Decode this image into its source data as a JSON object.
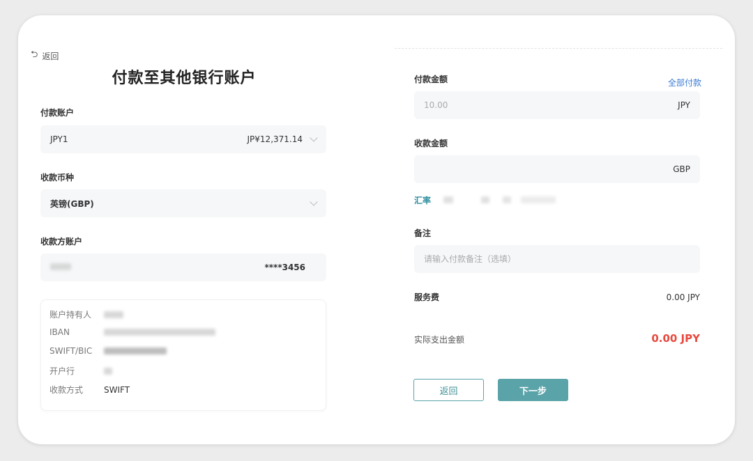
{
  "nav": {
    "back_label": "返回"
  },
  "page": {
    "title": "付款至其他银行账户"
  },
  "left": {
    "pay_account": {
      "label": "付款账户",
      "name": "JPY1",
      "balance": "JP¥12,371.14"
    },
    "receive_currency": {
      "label": "收款币种",
      "value": "英镑(GBP)"
    },
    "payee_account": {
      "label": "收款方账户",
      "masked_number": "****3456"
    },
    "details": {
      "holder_label": "账户持有人",
      "iban_label": "IBAN",
      "swift_label": "SWIFT/BIC",
      "bank_label": "开户行",
      "method_label": "收款方式",
      "method_value": "SWIFT"
    }
  },
  "right": {
    "pay_amount": {
      "label": "付款金额",
      "pay_all_label": "全部付款",
      "placeholder": "10.00",
      "currency": "JPY"
    },
    "receive_amount": {
      "label": "收款金额",
      "currency": "GBP"
    },
    "exchange_rate": {
      "label": "汇率"
    },
    "remark": {
      "label": "备注",
      "placeholder": "请输入付款备注（选填）"
    },
    "service_fee": {
      "label": "服务费",
      "value": "0.00 JPY"
    },
    "actual_amount": {
      "label": "实际支出金额",
      "value": "0.00 JPY"
    }
  },
  "actions": {
    "back_label": "返回",
    "next_label": "下一步"
  },
  "colors": {
    "accent": "#5aa3a8",
    "link": "#3a7bd5",
    "amount_red": "#e8493f"
  }
}
